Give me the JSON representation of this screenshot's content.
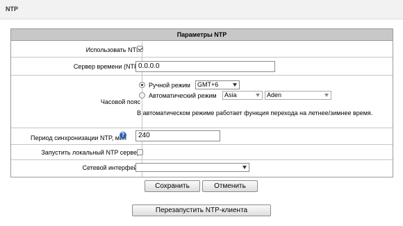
{
  "page": {
    "title": "NTP"
  },
  "panel": {
    "header": "Параметры NTP",
    "use_ntp": {
      "label": "Использовать NTP",
      "checked": true
    },
    "server": {
      "label": "Сервер времени (NTP)",
      "value": "0.0.0.0"
    },
    "timezone": {
      "label": "Часовой пояс",
      "manual_label": "Ручной режим",
      "manual_value": "GMT+6",
      "auto_label": "Автоматический режим",
      "auto_region": "Asia",
      "auto_city": "Aden",
      "selected_mode": "manual",
      "note": "В автоматическом режиме работает функция перехода на летнее/зимнее время."
    },
    "period": {
      "label": "Период синхронизации NTP, мин",
      "value": "240",
      "help_icon": "?"
    },
    "local_server": {
      "label": "Запустить локальный NTP сервер",
      "checked": false
    },
    "interface": {
      "label": "Сетевой интерфейс",
      "value": ""
    }
  },
  "buttons": {
    "save": "Сохранить",
    "cancel": "Отменить",
    "restart": "Перезапустить NTP-клиента"
  }
}
